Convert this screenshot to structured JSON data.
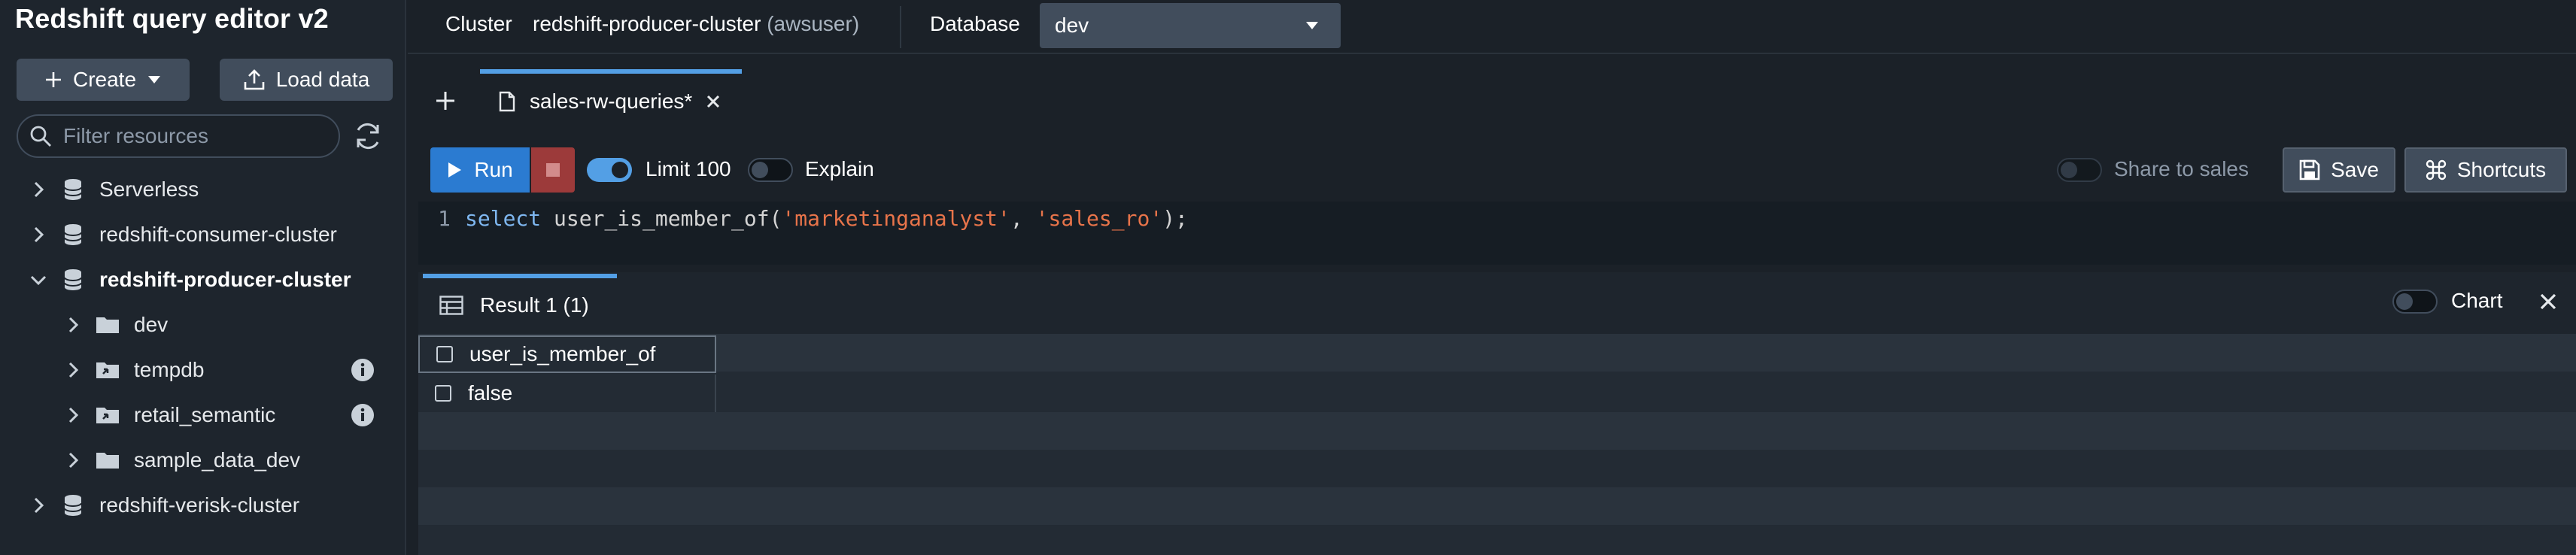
{
  "sidebar": {
    "title": "Redshift query editor v2",
    "create_label": "Create",
    "load_data_label": "Load data",
    "filter_placeholder": "Filter resources",
    "tree": [
      {
        "label": "Serverless",
        "expanded": false,
        "bold": false
      },
      {
        "label": "redshift-consumer-cluster",
        "expanded": false,
        "bold": false
      },
      {
        "label": "redshift-producer-cluster",
        "expanded": true,
        "bold": true
      },
      {
        "label": "dev",
        "expanded": false,
        "bold": false
      },
      {
        "label": "tempdb",
        "expanded": false,
        "bold": false,
        "info": true
      },
      {
        "label": "retail_semantic",
        "expanded": false,
        "bold": false,
        "info": true
      },
      {
        "label": "sample_data_dev",
        "expanded": false,
        "bold": false
      },
      {
        "label": "redshift-verisk-cluster",
        "expanded": false,
        "bold": false
      }
    ]
  },
  "topbar": {
    "cluster_label": "Cluster",
    "cluster_name": "redshift-producer-cluster",
    "cluster_user": "(awsuser)",
    "database_label": "Database",
    "database_value": "dev"
  },
  "tabs": [
    {
      "label": "sales-rw-queries*",
      "active": true
    }
  ],
  "toolbar": {
    "run_label": "Run",
    "limit_label": "Limit 100",
    "limit_enabled": true,
    "explain_label": "Explain",
    "explain_enabled": false,
    "share_label": "Share to sales",
    "share_enabled": false,
    "save_label": "Save",
    "shortcuts_label": "Shortcuts"
  },
  "editor": {
    "line_number": "1",
    "tokens": [
      {
        "text": "select",
        "type": "keyword"
      },
      {
        "text": " user_is_member_of(",
        "type": "plain"
      },
      {
        "text": "'marketinganalyst'",
        "type": "string"
      },
      {
        "text": ", ",
        "type": "plain"
      },
      {
        "text": "'sales_ro'",
        "type": "string"
      },
      {
        "text": ");",
        "type": "plain"
      }
    ]
  },
  "results": {
    "tab_label": "Result 1",
    "tab_count": "(1)",
    "chart_label": "Chart",
    "chart_enabled": false,
    "columns": [
      "user_is_member_of"
    ],
    "rows": [
      [
        "false"
      ]
    ]
  },
  "colors": {
    "accent": "#539fe5",
    "run_button": "#2b7bd1",
    "stop_button": "#9c3a3a",
    "keyword": "#7fb7f0",
    "string": "#e8744a"
  }
}
